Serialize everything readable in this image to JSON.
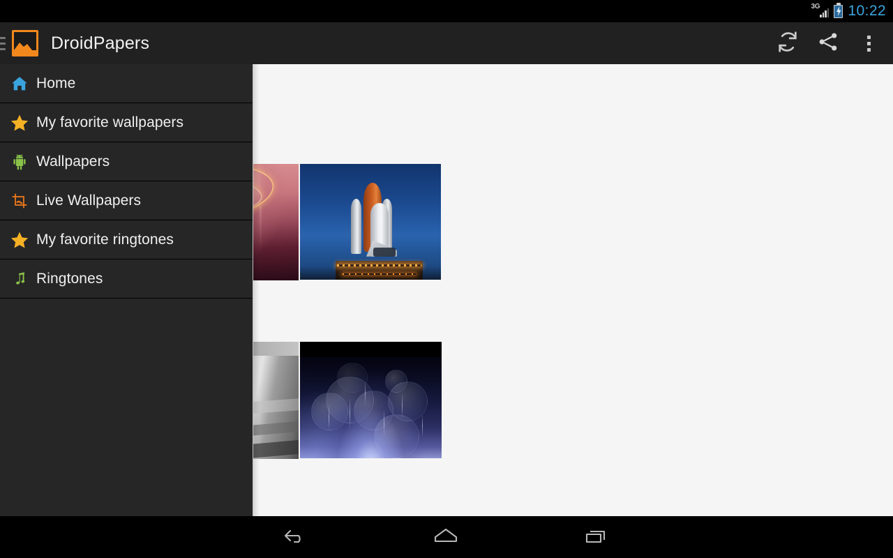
{
  "status_bar": {
    "network_label": "3G",
    "network_icon": "signal-bars-icon",
    "battery_icon": "battery-charging-icon",
    "clock": "10:22",
    "clock_color": "#3aa5dd"
  },
  "action_bar": {
    "menu_icon": "hamburger-menu-icon",
    "app_logo_icon": "droidpapers-logo-icon",
    "title": "DroidPapers",
    "actions": [
      {
        "name": "refresh-button",
        "icon": "refresh-icon",
        "label": "Refresh"
      },
      {
        "name": "share-button",
        "icon": "share-icon",
        "label": "Share"
      },
      {
        "name": "overflow-menu-button",
        "icon": "overflow-menu-icon",
        "label": "More options"
      }
    ],
    "background_color": "#212121"
  },
  "drawer": {
    "background_color": "#262626",
    "items": [
      {
        "label": "Home",
        "icon": "home-icon",
        "icon_color": "#3aa5dd"
      },
      {
        "label": "My favorite wallpapers",
        "icon": "star-icon",
        "icon_color": "#f5b125"
      },
      {
        "label": "Wallpapers",
        "icon": "android-robot-icon",
        "icon_color": "#8bc34a"
      },
      {
        "label": "Live Wallpapers",
        "icon": "crop-frame-icon",
        "icon_color": "#e8761a"
      },
      {
        "label": "My favorite ringtones",
        "icon": "star-icon",
        "icon_color": "#f5b125"
      },
      {
        "label": "Ringtones",
        "icon": "music-note-icon",
        "icon_color": "#8bc34a"
      }
    ]
  },
  "content": {
    "background_color": "#f5f5f5",
    "wallpapers": [
      {
        "name": "wallpaper-thumb-abstract-pink",
        "alt": "Pink abstract light rings wallpaper"
      },
      {
        "name": "wallpaper-thumb-space-shuttle",
        "alt": "Space shuttle on launchpad at dusk"
      },
      {
        "name": "wallpaper-thumb-grayscale-architecture",
        "alt": "Grayscale architectural stairs"
      },
      {
        "name": "wallpaper-thumb-dark-bokeh",
        "alt": "Dark blue bokeh light orbs wallpaper"
      }
    ]
  },
  "nav_bar": {
    "buttons": [
      {
        "name": "nav-back-button",
        "icon": "back-arrow-icon",
        "label": "Back"
      },
      {
        "name": "nav-home-button",
        "icon": "home-outline-icon",
        "label": "Home"
      },
      {
        "name": "nav-recents-button",
        "icon": "recents-icon",
        "label": "Recent apps"
      }
    ]
  }
}
